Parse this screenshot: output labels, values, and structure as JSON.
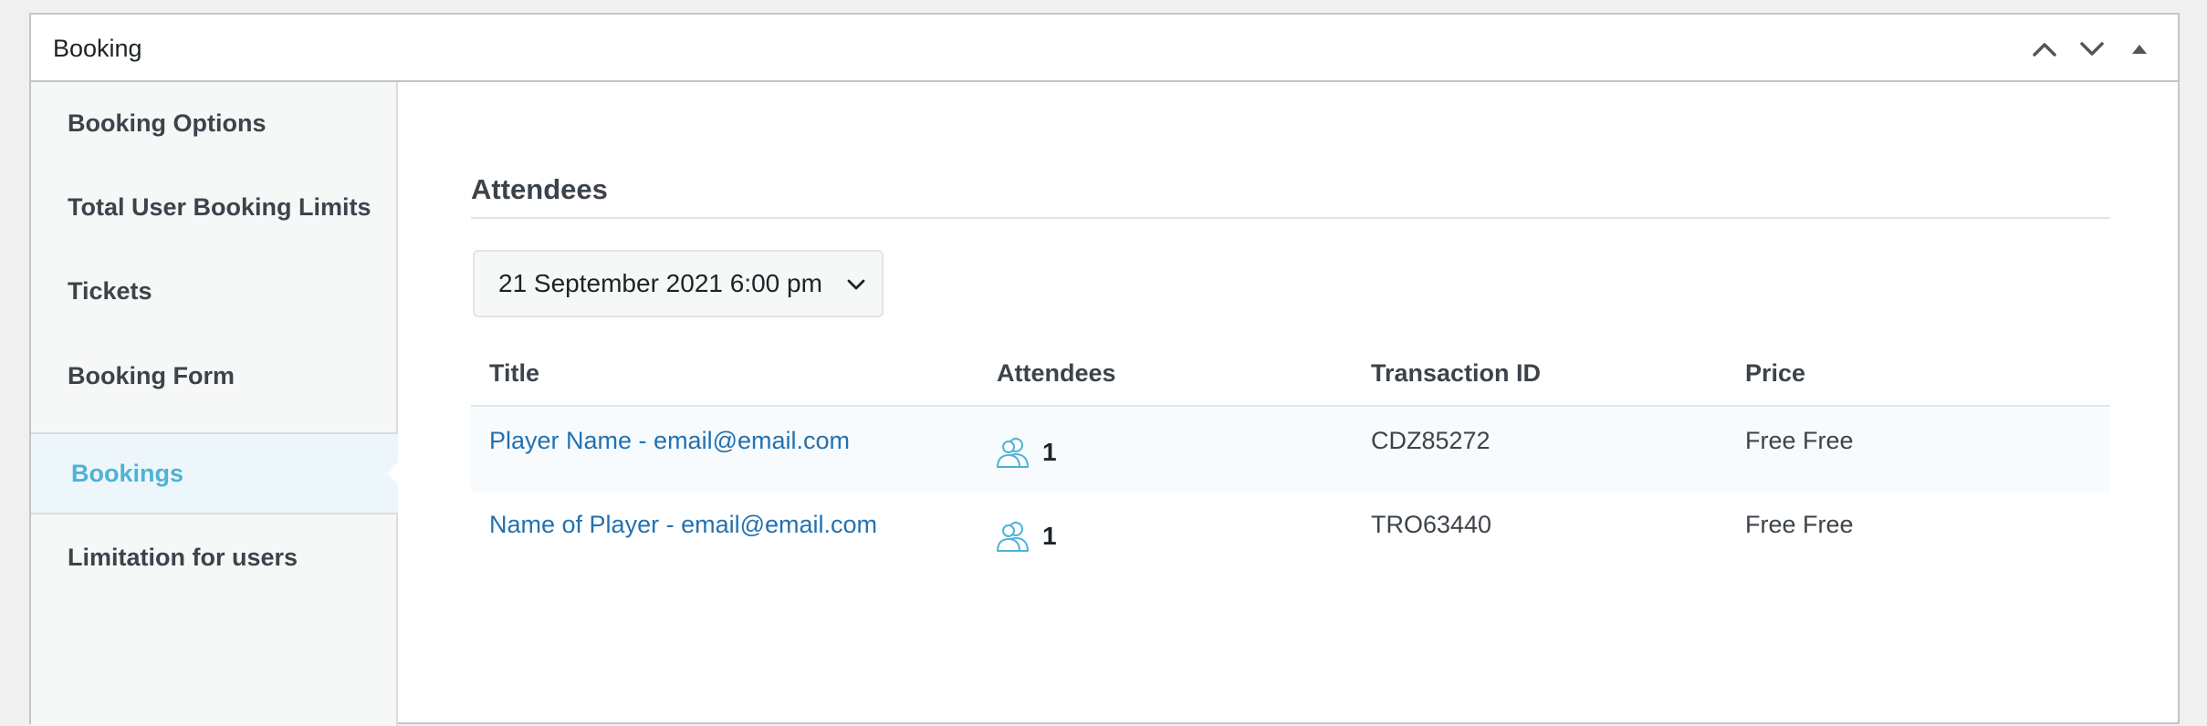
{
  "metabox": {
    "title": "Booking",
    "actions": [
      "chevron-up-icon",
      "chevron-down-icon",
      "triangle-up-icon"
    ]
  },
  "sidebar": {
    "items": [
      {
        "label": "Booking Options"
      },
      {
        "label": "Total User Booking Limits"
      },
      {
        "label": "Tickets"
      },
      {
        "label": "Booking Form"
      },
      {
        "label": "Bookings",
        "active": true
      },
      {
        "label": "Limitation for users"
      }
    ]
  },
  "main": {
    "section_title": "Attendees",
    "date_select": {
      "selected": "21 September 2021 6:00 pm"
    },
    "table": {
      "columns": [
        "Title",
        "Attendees",
        "Transaction ID",
        "Price"
      ],
      "rows": [
        {
          "title": "Player Name - email@email.com",
          "attendees": "1",
          "transaction_id": "CDZ85272",
          "price": "Free Free"
        },
        {
          "title": "Name of Player - email@email.com",
          "attendees": "1",
          "transaction_id": "TRO63440",
          "price": "Free Free"
        }
      ]
    }
  },
  "colors": {
    "accent": "#4fb2d7",
    "link": "#2271b1",
    "sidebar_bg": "#f6f7f7"
  }
}
